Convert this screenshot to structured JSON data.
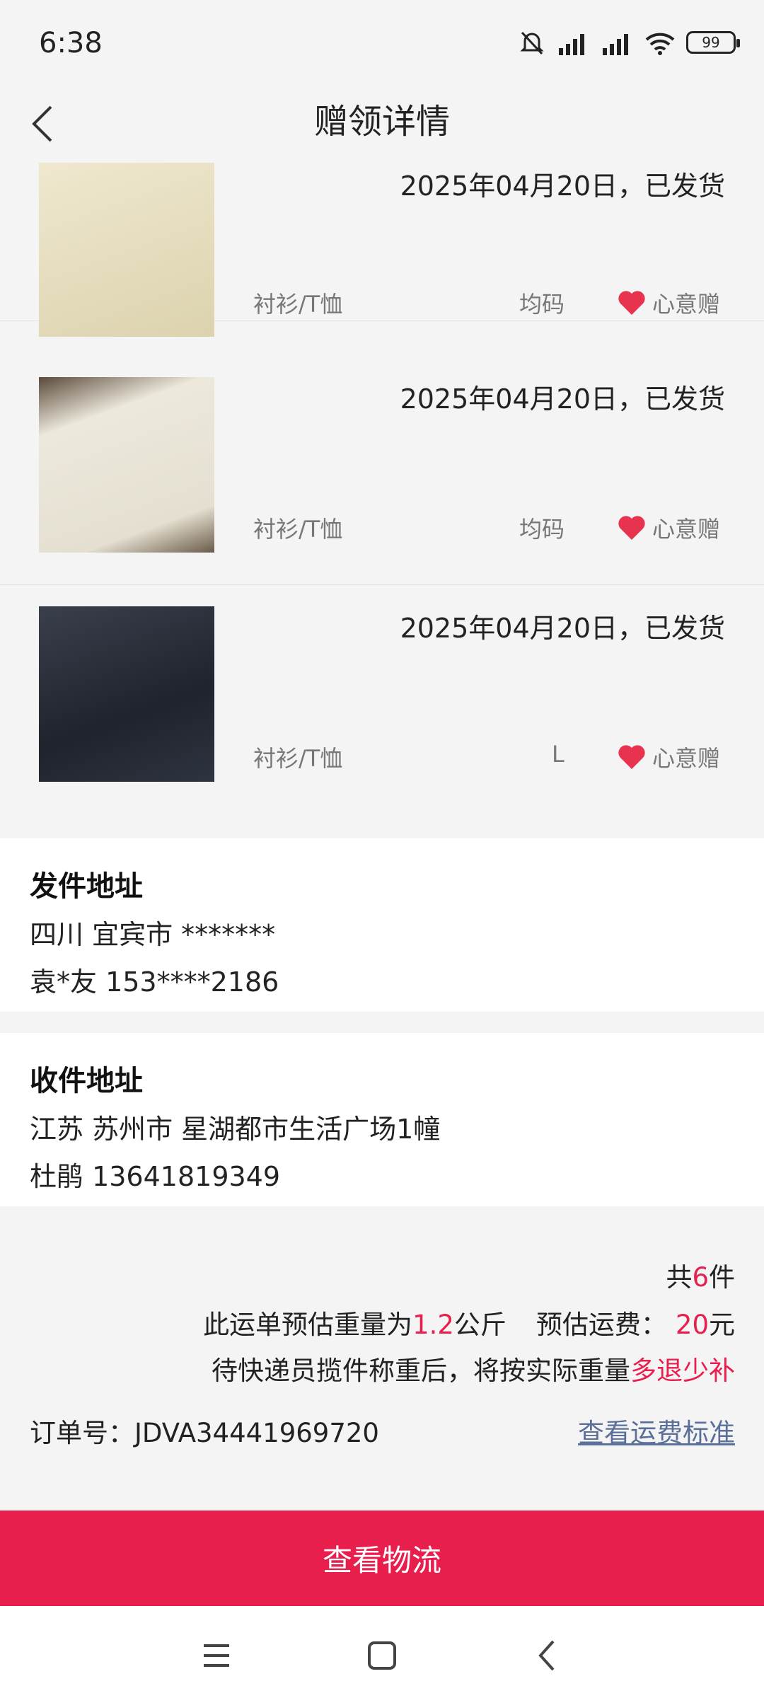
{
  "status": {
    "time": "6:38",
    "battery": "99"
  },
  "nav": {
    "title": "赠领详情"
  },
  "items": [
    {
      "date": "2025年04月20日，已发货",
      "category": "衬衫/T恤",
      "size": "均码",
      "tag": "心意赠",
      "thumb_color": "#e9e1c4"
    },
    {
      "date": "2025年04月20日，已发货",
      "category": "衬衫/T恤",
      "size": "均码",
      "tag": "心意赠",
      "thumb_color": "#e8e4d6"
    },
    {
      "date": "2025年04月20日，已发货",
      "category": "衬衫/T恤",
      "size": "L",
      "tag": "心意赠",
      "thumb_color": "#2b2f3a"
    }
  ],
  "sender": {
    "title": "发件地址",
    "address": "四川 宜宾市 *******",
    "contact": "袁*友 153****2186"
  },
  "receiver": {
    "title": "收件地址",
    "address": "江苏 苏州市 星湖都市生活广场1幢",
    "contact": "杜鹃 13641819349"
  },
  "summary": {
    "count_prefix": "共",
    "count": "6",
    "count_suffix": "件",
    "weight_prefix": "此运单预估重量为",
    "weight": "1.2",
    "weight_unit": "公斤",
    "fee_prefix": "预估运费：",
    "fee": "20",
    "fee_unit": "元",
    "note_prefix": "待快递员揽件称重后，将按实际重量",
    "note_highlight": "多退少补",
    "order_label": "订单号：",
    "order_no": "JDVA34441969720",
    "fee_standard_link": "查看运费标准"
  },
  "cta": {
    "label": "查看物流"
  },
  "colors": {
    "accent": "#e81e4d",
    "link": "#5a6f9a",
    "background": "#f4f4f4"
  }
}
